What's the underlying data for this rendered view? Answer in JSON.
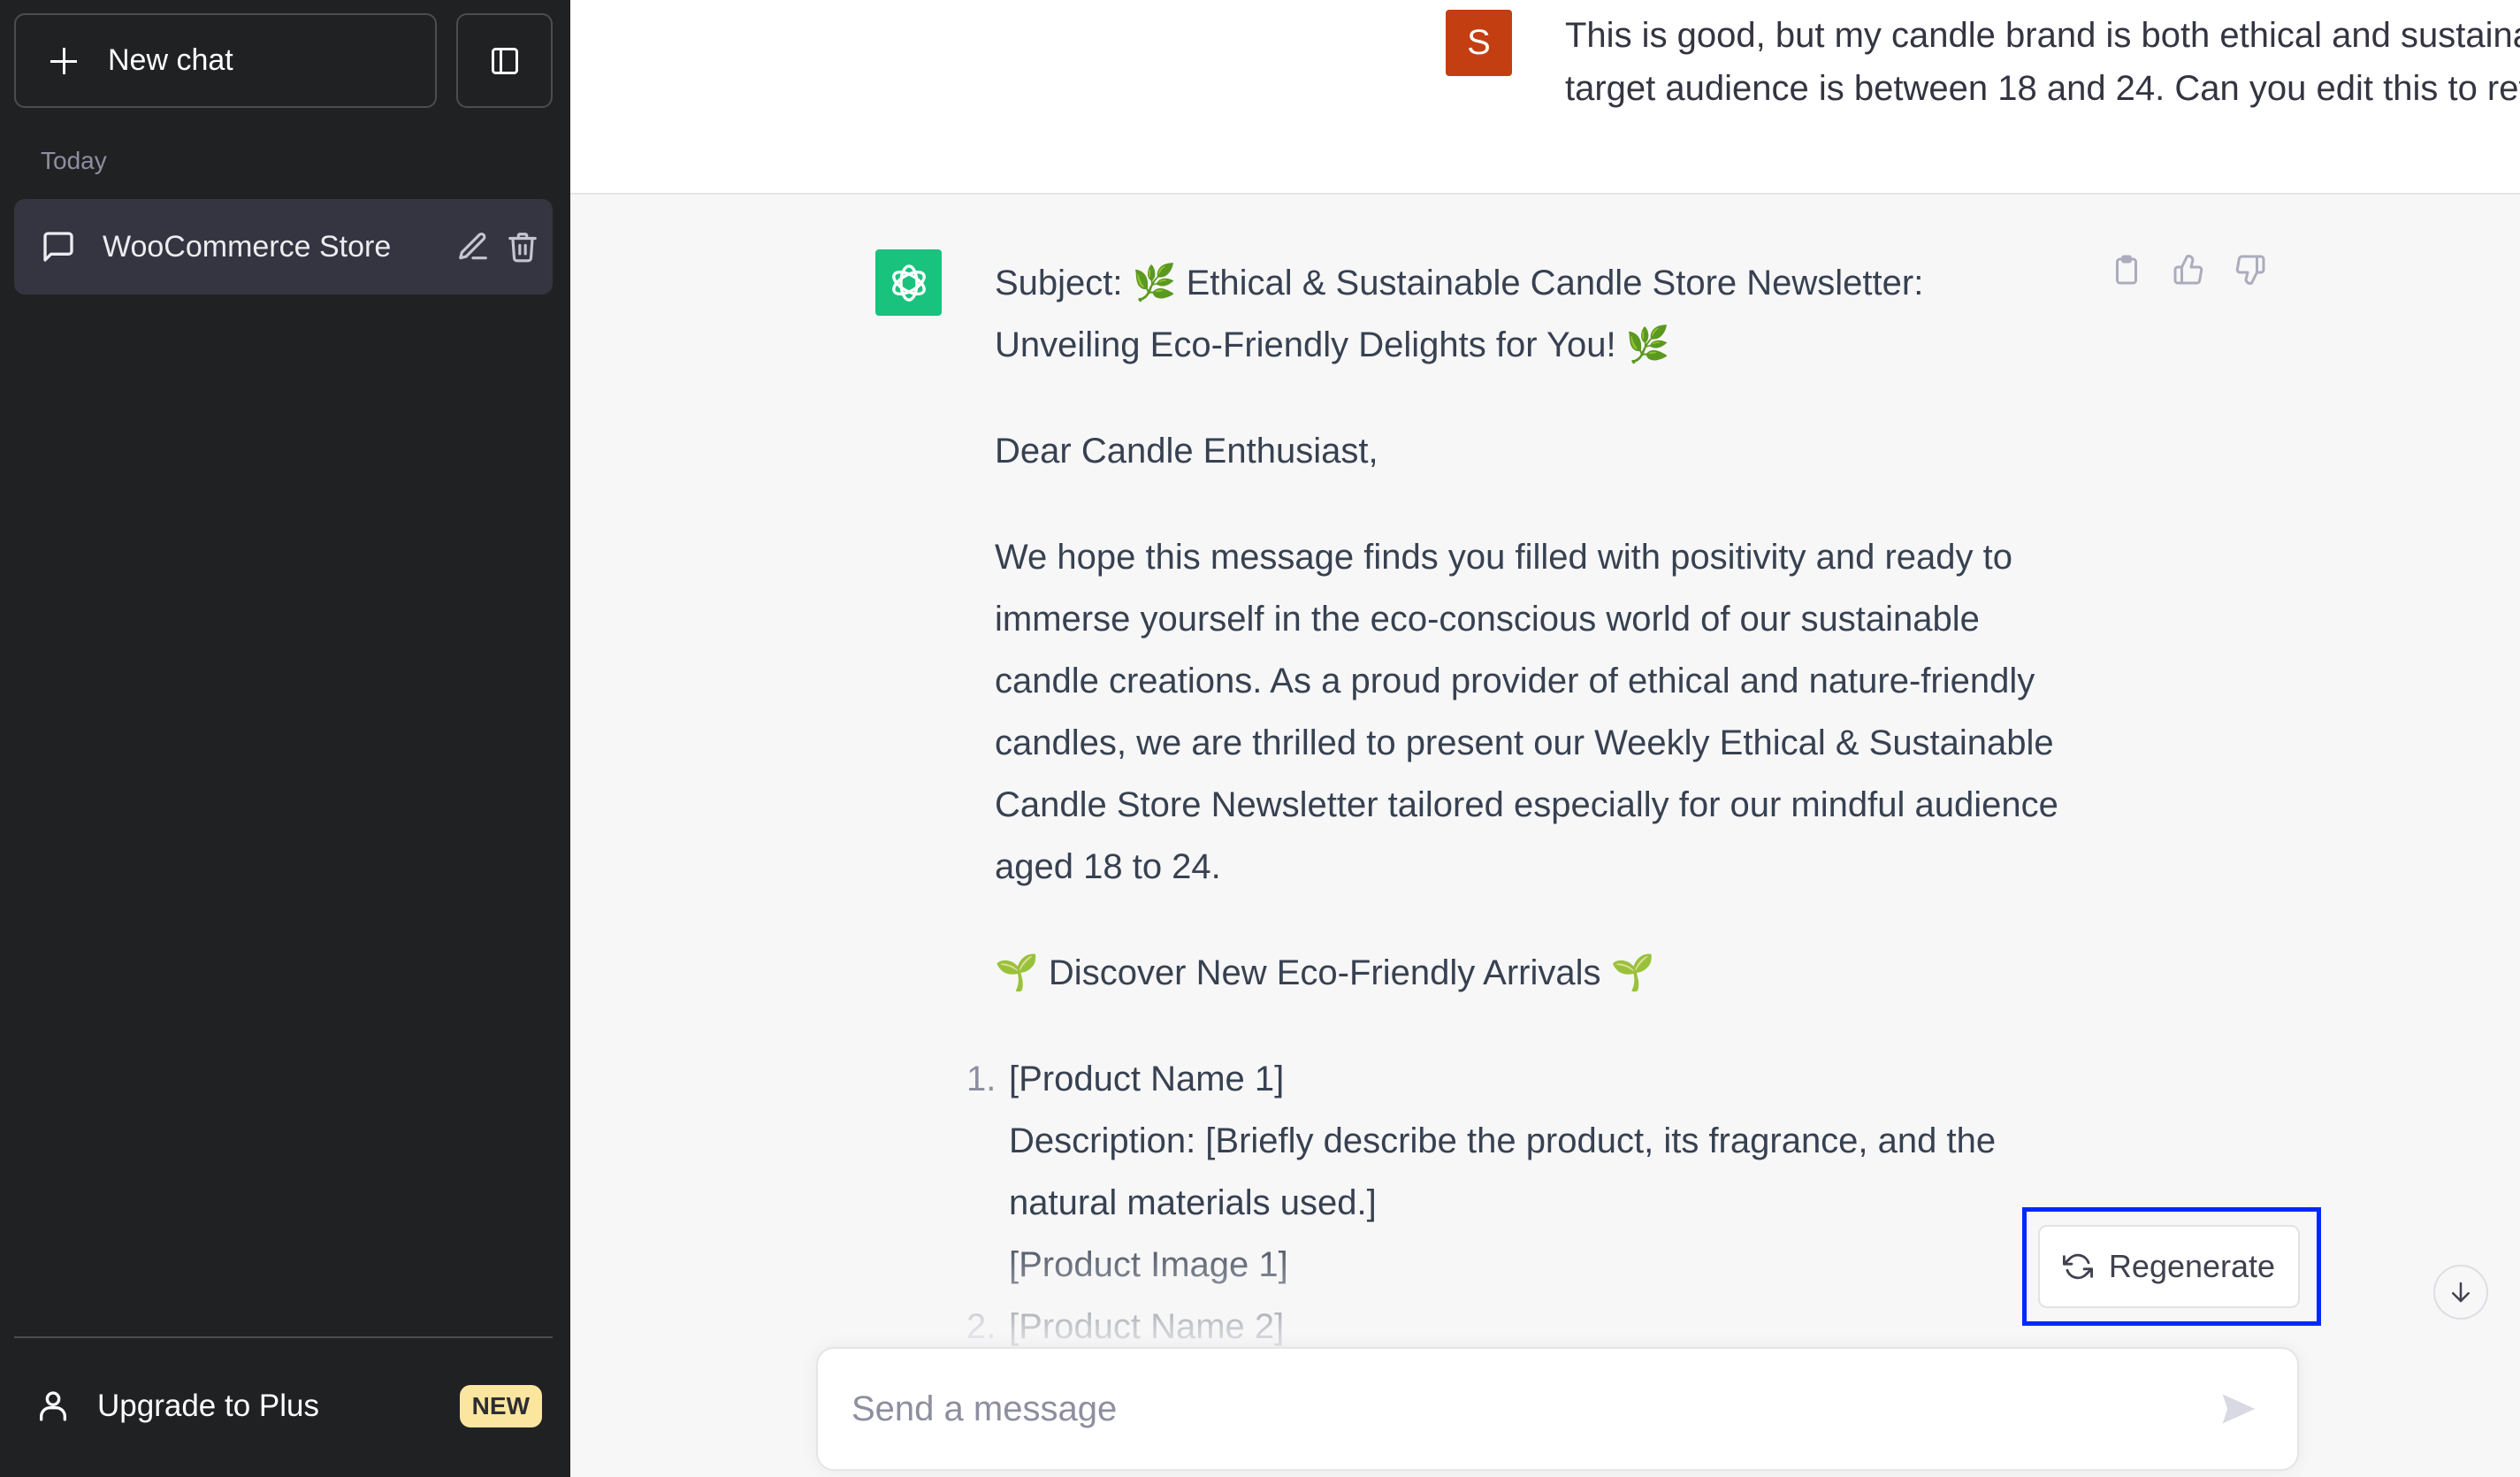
{
  "sidebar": {
    "new_chat_label": "New chat",
    "section_label": "Today",
    "chats": [
      {
        "title": "WooCommerce Store",
        "active": true
      }
    ],
    "upgrade_label": "Upgrade to Plus",
    "upgrade_badge": "NEW"
  },
  "conversation": {
    "user_avatar_letter": "S",
    "user_message": "This is good, but my candle brand is both ethical and sustainable. Its target audience is between 18 and 24. Can you edit this to reflect that?",
    "assistant": {
      "subject": "Subject: 🌿 Ethical & Sustainable Candle Store Newsletter: Unveiling Eco-Friendly Delights for You! 🌿",
      "greeting": "Dear Candle Enthusiast,",
      "intro": "We hope this message finds you filled with positivity and ready to immerse yourself in the eco-conscious world of our sustainable candle creations. As a proud provider of ethical and nature-friendly candles, we are thrilled to present our Weekly Ethical & Sustainable Candle Store Newsletter tailored especially for our mindful audience aged 18 to 24.",
      "section_heading": "🌱 Discover New Eco-Friendly Arrivals 🌱",
      "list": [
        {
          "num": "1.",
          "name": "[Product Name 1]",
          "description": "Description: [Briefly describe the product, its fragrance, and the natural materials used.]",
          "image": "[Product Image 1]"
        },
        {
          "num": "2.",
          "name": "[Product Name 2]"
        }
      ]
    }
  },
  "actions": {
    "regenerate_label": "Regenerate"
  },
  "composer": {
    "placeholder": "Send a message",
    "value": ""
  },
  "colors": {
    "sidebar_bg": "#202123",
    "user_avatar": "#c33e11",
    "assistant_avatar": "#19c37d",
    "highlight": "#0029ff",
    "badge": "#fae69e"
  }
}
